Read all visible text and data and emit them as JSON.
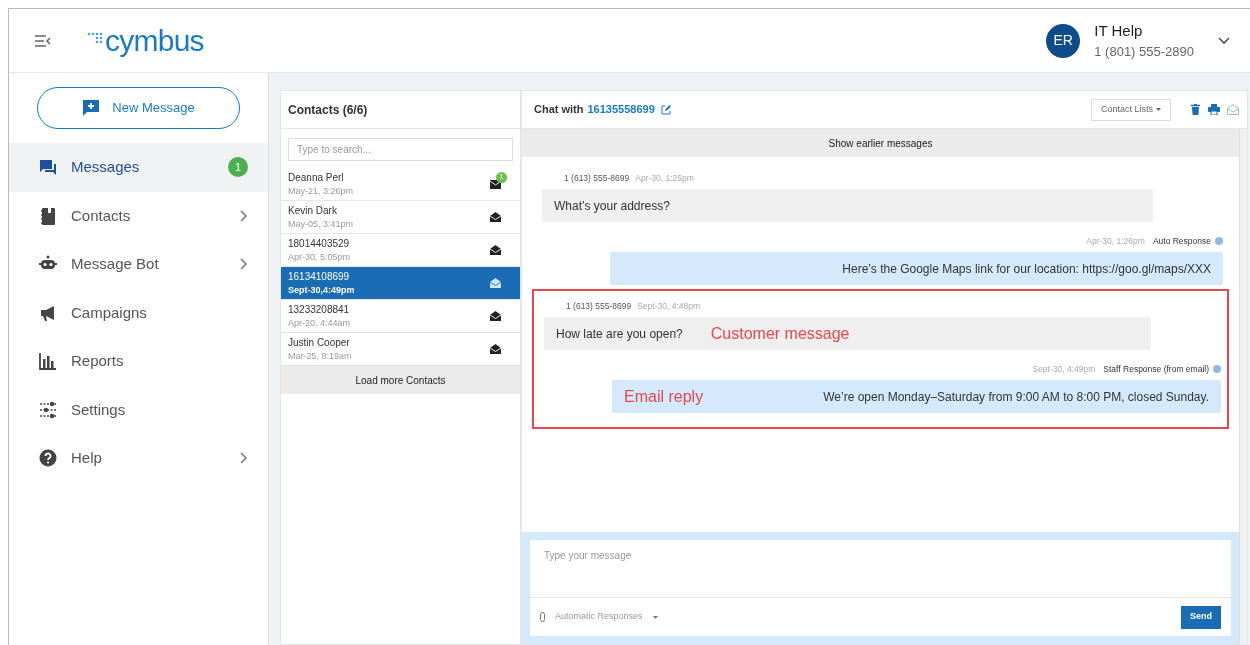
{
  "header": {
    "logo": "cymbus",
    "user": {
      "initials": "ER",
      "name": "IT Help",
      "phone": "1 (801) 555-2890"
    }
  },
  "sidebar": {
    "new_message": "New Message",
    "items": [
      {
        "kind": "messages",
        "label": "Messages",
        "selected": true,
        "badge": "1",
        "has_submenu": false
      },
      {
        "kind": "contacts",
        "label": "Contacts",
        "selected": false,
        "has_submenu": true
      },
      {
        "kind": "bot",
        "label": "Message Bot",
        "selected": false,
        "has_submenu": true
      },
      {
        "kind": "campaigns",
        "label": "Campaigns",
        "selected": false,
        "has_submenu": false
      },
      {
        "kind": "reports",
        "label": "Reports",
        "selected": false,
        "has_submenu": false
      },
      {
        "kind": "settings",
        "label": "Settings",
        "selected": false,
        "has_submenu": false
      },
      {
        "kind": "help",
        "label": "Help",
        "selected": false,
        "has_submenu": true
      }
    ]
  },
  "contacts": {
    "title": "Contacts (6/6)",
    "search": {
      "placeholder": "Type to search..."
    },
    "items": [
      {
        "name": "Deanna Perl",
        "time": "May-21, 3:26pm",
        "read": false,
        "unread_count": "1",
        "selected": false
      },
      {
        "name": "Kevin Dark",
        "time": "May-05, 3:41pm",
        "read": true,
        "selected": false
      },
      {
        "name": "18014403529",
        "time": "Apr-30, 5:05pm",
        "read": true,
        "selected": false
      },
      {
        "name": "16134108699",
        "time": "Sept-30,4:49pm",
        "read": true,
        "selected": true
      },
      {
        "name": "13233208841",
        "time": "Apr-20, 4:44am",
        "read": true,
        "selected": false
      },
      {
        "name": "Justin Cooper",
        "time": "Mar-25, 8:19am",
        "read": true,
        "selected": false
      }
    ],
    "load_more": "Load more Contacts"
  },
  "chat": {
    "title_prefix": "Chat with",
    "number": "16135558699",
    "contact_lists": "Contact Lists",
    "show_earlier": "Show earlier messages",
    "messages": [
      {
        "kind": "incoming",
        "sender": "1 (613) 555-8699",
        "time": "Apr-30, 1:25pm",
        "text": "What’s your address?",
        "highlighted": false
      },
      {
        "kind": "outgoing",
        "sender": "Auto Response",
        "time": "Apr-30, 1:26pm",
        "text": "Here’s the Google Maps link for our location: https://goo.gl/maps/XXX",
        "highlighted": false
      },
      {
        "kind": "incoming",
        "sender": "1 (613) 555-8699",
        "time": "Sept-30, 4:48pm",
        "text": "How late are you open?",
        "annotation": "Customer message",
        "highlighted": true
      },
      {
        "kind": "outgoing",
        "sender": "Staff Response (from email)",
        "time": "Sept-30, 4:49pm",
        "text": "We’re open Monday–Saturday from 9:00 AM to 8:00 PM, closed Sunday.",
        "annotation": "Email reply",
        "highlighted": true
      }
    ],
    "composer": {
      "placeholder": "Type your message",
      "auto_responses": "Automatic Responses",
      "send": "Send"
    }
  }
}
